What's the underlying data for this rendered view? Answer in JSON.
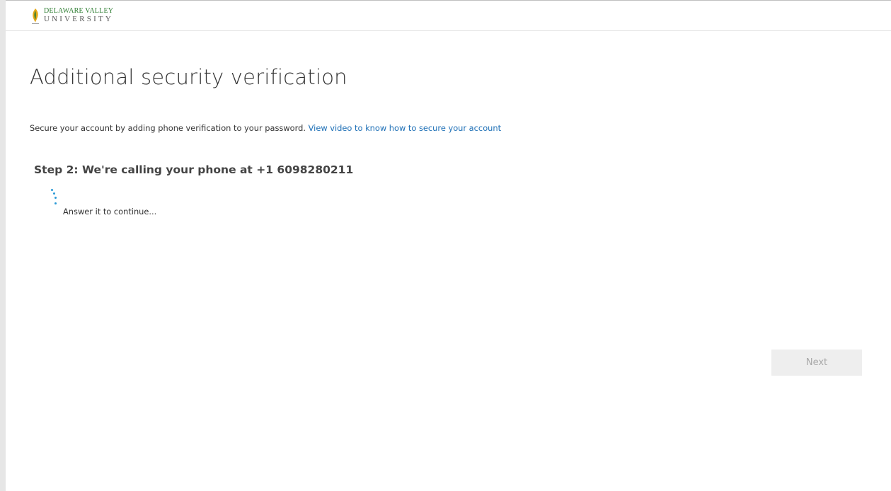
{
  "header": {
    "logo": {
      "line1": "DELAWARE VALLEY",
      "line2": "UNIVERSITY",
      "icon": "leaf-flame-icon"
    }
  },
  "main": {
    "title": "Additional security verification",
    "intro_text": "Secure your account by adding phone verification to your password.",
    "intro_link": "View video to know how to secure your account",
    "step_heading": "Step 2: We're calling your phone at +1 6098280211",
    "status_text": "Answer it to continue...",
    "spinner_icon": "loading-spinner-icon"
  },
  "actions": {
    "next_label": "Next"
  },
  "colors": {
    "link": "#1d6fb6",
    "spinner": "#2b9ad6",
    "logo_green": "#2e7d32",
    "logo_gold": "#e6a817"
  }
}
